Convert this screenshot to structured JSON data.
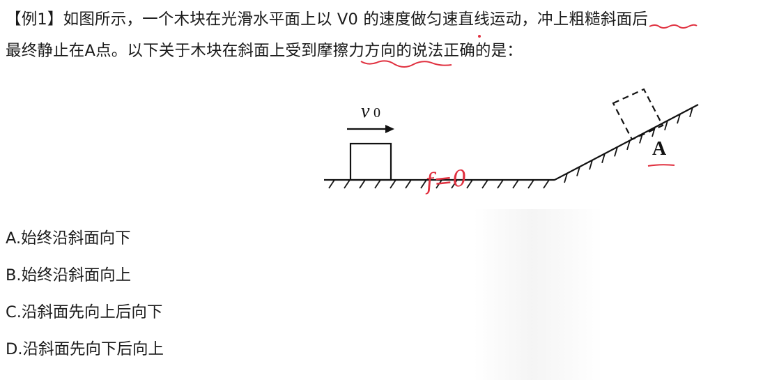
{
  "question": {
    "line1": "【例1】如图所示，一个木块在光滑水平面上以 V0 的速度做匀速直线运动，冲上粗糙斜面后",
    "line2": "最终静止在A点。以下关于木块在斜面上受到摩擦力方向的说法正确的是："
  },
  "figure": {
    "velocity_label": "v",
    "velocity_subscript": "0",
    "point_label": "A",
    "handwritten_note": "f=0"
  },
  "options": [
    {
      "label": "A.始终沿斜面向下"
    },
    {
      "label": "B.始终沿斜面向上"
    },
    {
      "label": "C.沿斜面先向上后向下"
    },
    {
      "label": "D.沿斜面先向下后向上"
    }
  ],
  "colors": {
    "text": "#1a1a1a",
    "annotation": "#e0303f"
  }
}
